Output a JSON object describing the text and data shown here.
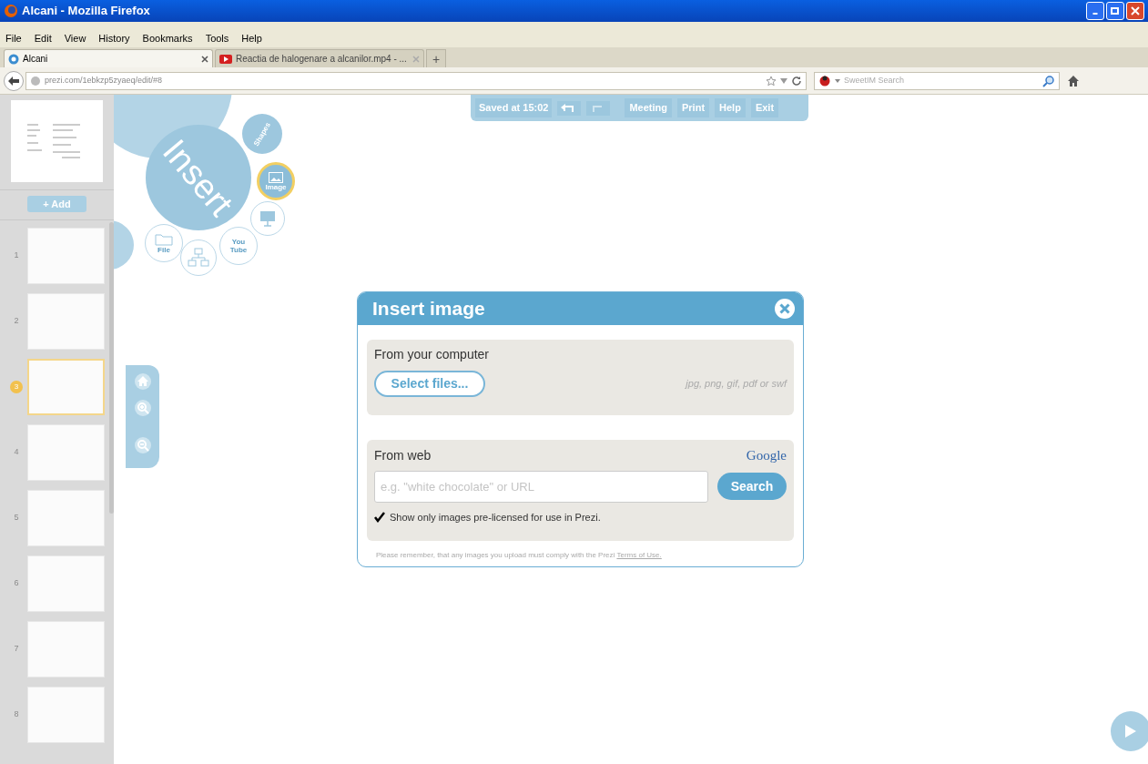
{
  "window": {
    "title": "Alcani - Mozilla Firefox"
  },
  "menu": [
    "File",
    "Edit",
    "View",
    "History",
    "Bookmarks",
    "Tools",
    "Help"
  ],
  "tabs": [
    {
      "label": "Alcani",
      "selected": true,
      "kind": "prezi"
    },
    {
      "label": "Reactia de halogenare a alcanilor.mp4 - ...",
      "selected": false,
      "kind": "video"
    }
  ],
  "new_tab": "+",
  "address": {
    "url": "prezi.com/1ebkzp5zyaeq/edit/#8"
  },
  "search": {
    "placeholder": "SweetIM Search"
  },
  "toolbar": {
    "saved": "Saved at 15:02",
    "buttons": [
      "Meeting",
      "Print",
      "Help",
      "Exit"
    ]
  },
  "sidebar": {
    "add": "+ Add",
    "slides": [
      {
        "number": "1",
        "selected": false
      },
      {
        "number": "2",
        "selected": false
      },
      {
        "number": "3",
        "selected": true
      },
      {
        "number": "4",
        "selected": false
      },
      {
        "number": "5",
        "selected": false
      },
      {
        "number": "6",
        "selected": false
      },
      {
        "number": "7",
        "selected": false
      },
      {
        "number": "8",
        "selected": false
      }
    ]
  },
  "insert_menu": {
    "title": "Insert",
    "items": [
      {
        "kind": "shapes",
        "label": "Shapes",
        "selected": false
      },
      {
        "kind": "image",
        "label": "Image",
        "selected": true
      },
      {
        "kind": "file",
        "label": "File",
        "selected": false
      },
      {
        "kind": "youtube",
        "label": "You Tube",
        "selected": false
      }
    ]
  },
  "dialog": {
    "title": "Insert image",
    "computer": {
      "heading": "From your computer",
      "button": "Select files...",
      "formats": "jpg, png, gif, pdf or swf"
    },
    "web": {
      "heading": "From web",
      "provider": "Google",
      "placeholder": "e.g. \"white chocolate\" or URL",
      "button": "Search",
      "license": {
        "label": "Show only images pre-licensed for use in Prezi.",
        "checked": true
      }
    },
    "note": "Please remember, that any images you upload must comply with the Prezi",
    "note_link": "Terms of Use."
  }
}
